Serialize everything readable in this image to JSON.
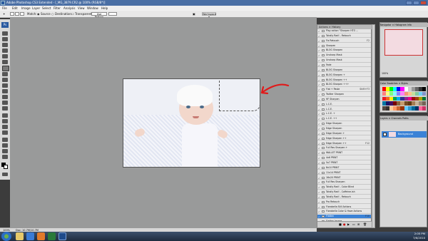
{
  "window": {
    "title": "Adobe Photoshop CS3 Extended - [_MG_3879.CR2 @ 100% (RGB/8*)]"
  },
  "menu": [
    "File",
    "Edit",
    "Image",
    "Layer",
    "Select",
    "Filter",
    "Analysis",
    "View",
    "Window",
    "Help"
  ],
  "options": {
    "sample_size_label": "Sample",
    "match_label": "Match:",
    "source_label": "Source",
    "destination_label": "Destination",
    "transparent_label": "Transparent",
    "use_pattern_label": "Use Pattern",
    "workspace_label": "Workspace ▾"
  },
  "actions_panel": {
    "tabs": "Actions ×  History",
    "rows": [
      {
        "label": "Play action \"Sharpen HTO ...",
        "shortcut": "",
        "selected": false
      },
      {
        "label": "Totally Rad! - Retouch",
        "shortcut": "",
        "selected": false
      },
      {
        "label": "Fix Retouch",
        "shortcut": "F2",
        "selected": false
      },
      {
        "label": "Sharpen",
        "shortcut": "",
        "selected": false
      },
      {
        "label": "BLOG Sharpen",
        "shortcut": "",
        "selected": false
      },
      {
        "label": "Unsharp Mask",
        "shortcut": "",
        "selected": false
      },
      {
        "label": "Unsharp Mask",
        "shortcut": "",
        "selected": false
      },
      {
        "label": "Fade",
        "shortcut": "",
        "selected": false
      },
      {
        "label": "BLOG Sharpen",
        "shortcut": "",
        "selected": false
      },
      {
        "label": "BLOG Sharpen +",
        "shortcut": "",
        "selected": false
      },
      {
        "label": "BLOG Sharpen ++",
        "shortcut": "",
        "selected": false
      },
      {
        "label": "BLOG Sharpen +++",
        "shortcut": "",
        "selected": false
      },
      {
        "label": "Flat + Paste",
        "shortcut": "Shift+F3",
        "selected": false
      },
      {
        "label": "Twitter Sharpen",
        "shortcut": "",
        "selected": false
      },
      {
        "label": "HF Sharpen",
        "shortcut": "",
        "selected": false
      },
      {
        "label": "L.C.E.",
        "shortcut": "",
        "selected": false
      },
      {
        "label": "L.C.E.",
        "shortcut": "",
        "selected": false
      },
      {
        "label": "L.C.E. +",
        "shortcut": "",
        "selected": false
      },
      {
        "label": "L.C.E. ++",
        "shortcut": "",
        "selected": false
      },
      {
        "label": "Edge Sharpen",
        "shortcut": "",
        "selected": false
      },
      {
        "label": "Edge Sharpen",
        "shortcut": "",
        "selected": false
      },
      {
        "label": "Edge Sharpen +",
        "shortcut": "",
        "selected": false
      },
      {
        "label": "Edge Sharpen ++",
        "shortcut": "",
        "selected": false
      },
      {
        "label": "Edge Sharpen ++",
        "shortcut": "F12",
        "selected": false
      },
      {
        "label": "Full Res Sharpen +",
        "shortcut": "",
        "selected": false
      },
      {
        "label": "WALLET PRINT",
        "shortcut": "",
        "selected": false
      },
      {
        "label": "4x6 PRINT",
        "shortcut": "",
        "selected": false
      },
      {
        "label": "5x7 PRINT",
        "shortcut": "",
        "selected": false
      },
      {
        "label": "8x10 PRINT",
        "shortcut": "",
        "selected": false
      },
      {
        "label": "11x14 PRINT",
        "shortcut": "",
        "selected": false
      },
      {
        "label": "16x20 PRINT",
        "shortcut": "",
        "selected": false
      },
      {
        "label": "Full Res Sharpen",
        "shortcut": "",
        "selected": false
      },
      {
        "label": "Totally Rad! - Color Blind",
        "shortcut": "",
        "selected": false
      },
      {
        "label": "Totally Rad! - Caffeine.ish",
        "shortcut": "",
        "selected": false
      },
      {
        "label": "Totally Rad! - Retouch",
        "shortcut": "",
        "selected": false
      },
      {
        "label": "Pro Retouch",
        "shortcut": "",
        "selected": false
      },
      {
        "label": "Florabella Still Actions",
        "shortcut": "",
        "selected": false
      },
      {
        "label": "Florabella Color & Haze Actions",
        "shortcut": "",
        "selected": false
      },
      {
        "label": "Flatten",
        "shortcut": "F10",
        "selected": true
      },
      {
        "label": "Flatten Image",
        "shortcut": "",
        "selected": false
      }
    ]
  },
  "navigator": {
    "tabs": "Navigator ×  Histogram  Info",
    "zoom": "100%"
  },
  "color_panel": {
    "tabs": "Color  Swatches ×  Styles"
  },
  "layers_panel": {
    "tabs": "Layers ×  Channels  Paths",
    "layer_name": "Background"
  },
  "status": {
    "zoom": "100%",
    "doc": "Doc: 10.7M/10.7M"
  },
  "taskbar": {
    "time": "2:05 PM",
    "date": "7/6/2010"
  },
  "colors": {
    "accent": "#3b82d6",
    "annotation": "#e01a1a"
  }
}
